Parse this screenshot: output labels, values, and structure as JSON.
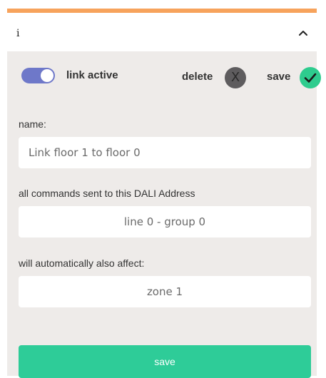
{
  "panel": {
    "title": "i",
    "accent_color": "#F7A35C",
    "collapse_icon": "chevron-up-icon"
  },
  "toolbar": {
    "toggle_label": "link active",
    "toggle_on": true,
    "toggle_color": "#6E78C9",
    "delete_label": "delete",
    "delete_icon_glyph": "X",
    "delete_icon": "close-circle-icon",
    "save_label": "save",
    "save_icon": "check-circle-icon",
    "save_color": "#2ECC8E"
  },
  "form": {
    "name_label": "name:",
    "name_value": "Link floor 1 to floor 0",
    "source_label": "all commands sent to this DALI Address",
    "source_value": "line 0 - group 0",
    "target_label": "will automatically also affect:",
    "target_value": "zone 1"
  },
  "footer": {
    "save_button_label": "save",
    "save_button_color": "#2ECC98"
  }
}
